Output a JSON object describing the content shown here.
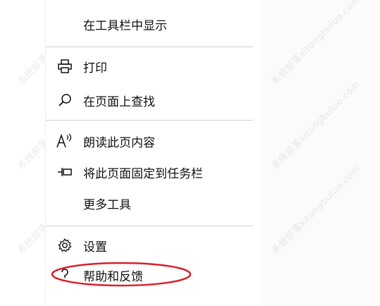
{
  "menu": {
    "items": [
      {
        "label": "在工具栏中显示",
        "icon": "none"
      },
      {
        "label": "打印",
        "icon": "printer-icon"
      },
      {
        "label": "在页面上查找",
        "icon": "search-icon"
      },
      {
        "label": "朗读此页内容",
        "icon": "read-aloud-icon"
      },
      {
        "label": "将此页面固定到任务栏",
        "icon": "pin-icon"
      },
      {
        "label": "更多工具",
        "icon": "none"
      },
      {
        "label": "设置",
        "icon": "gear-icon"
      },
      {
        "label": "帮助和反馈",
        "icon": "help-icon"
      }
    ]
  },
  "watermark": {
    "text": "系统部落xitongbuluo.com"
  },
  "colors": {
    "highlight": "#d8202a",
    "separator": "#cfcfcf",
    "text": "#111111"
  }
}
